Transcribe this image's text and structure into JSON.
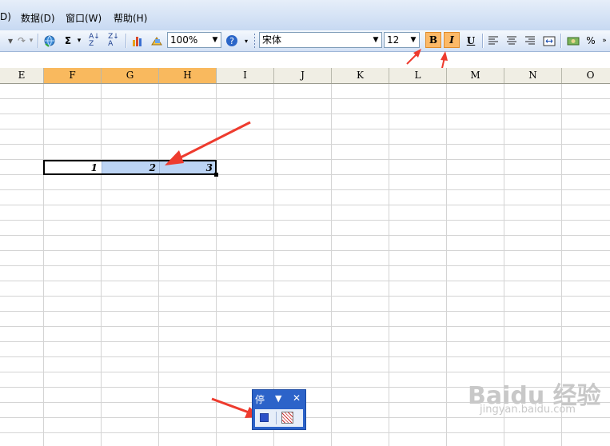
{
  "menu": {
    "items": [
      {
        "label": "D)"
      },
      {
        "label": "数据(D)"
      },
      {
        "label": "窗口(W)"
      },
      {
        "label": "帮助(H)"
      }
    ]
  },
  "toolbar": {
    "zoom_value": "100%",
    "font_name": "宋体",
    "font_size": "12",
    "bold_label": "B",
    "italic_label": "I",
    "underline_label": "U",
    "percent_label": "%",
    "sigma_label": "Σ"
  },
  "columns": [
    "E",
    "F",
    "G",
    "H",
    "I",
    "J",
    "K",
    "L",
    "M",
    "N",
    "O"
  ],
  "selected_columns": [
    "F",
    "G",
    "H"
  ],
  "cells": [
    {
      "ref": "F6",
      "value": "1"
    },
    {
      "ref": "G6",
      "value": "2"
    },
    {
      "ref": "H6",
      "value": "3"
    }
  ],
  "float_toolbar": {
    "title": "停",
    "caret": "▼",
    "close": "✕"
  },
  "watermark": {
    "main": "Baidu 经验",
    "sub": "jingyan.baidu.com"
  },
  "colors": {
    "selected_header": "#f9b95e",
    "selected_cell": "#bcd4f4",
    "format_button_active": "#fcb967",
    "annotation_arrow": "#ee3b2e"
  }
}
